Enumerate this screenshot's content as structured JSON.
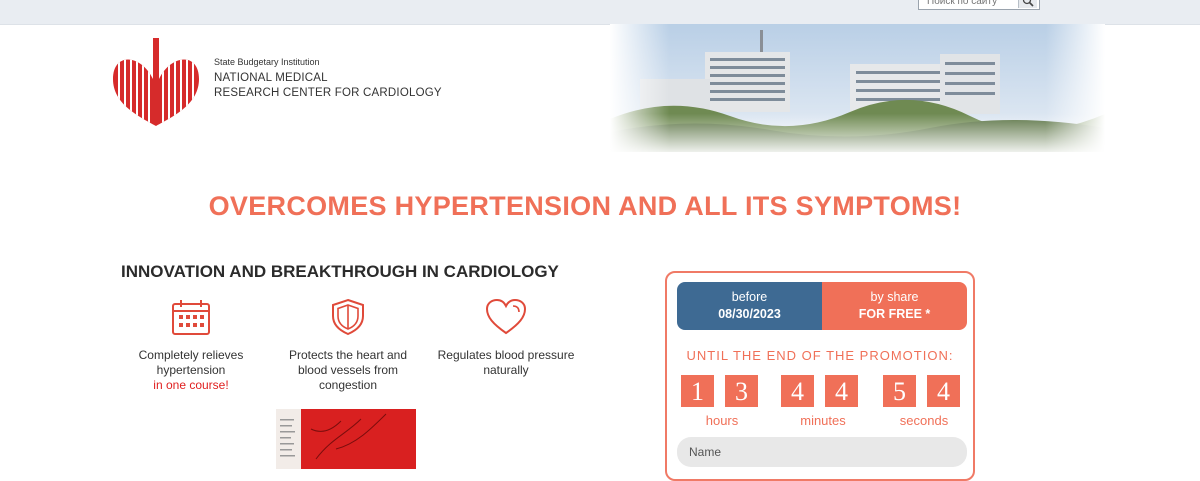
{
  "topbar": {
    "search_placeholder": "Поиск по сайту"
  },
  "org": {
    "small": "State Budgetary Institution",
    "line1": "NATIONAL MEDICAL",
    "line2": "RESEARCH CENTER FOR CARDIOLOGY"
  },
  "headline": "OVERCOMES HYPERTENSION AND ALL ITS SYMPTOMS!",
  "subhead": "INNOVATION AND BREAKTHROUGH IN CARDIOLOGY",
  "features": [
    {
      "icon": "calendar-icon",
      "text": "Completely relieves hypertension",
      "accent": "in one course!"
    },
    {
      "icon": "shield-icon",
      "text": "Protects the heart and blood vessels from congestion"
    },
    {
      "icon": "heart-icon",
      "text": "Regulates blood pressure naturally"
    }
  ],
  "offer": {
    "left_line1": "before",
    "left_line2": "08/30/2023",
    "right_line1": "by share",
    "right_line2": "FOR FREE *"
  },
  "promo_label": "UNTIL THE END OF THE PROMOTION:",
  "countdown": {
    "digits": [
      "1",
      "3",
      "4",
      "4",
      "5",
      "4"
    ],
    "hours_label": "hours",
    "minutes_label": "minutes",
    "seconds_label": "seconds"
  },
  "form": {
    "name_placeholder": "Name"
  },
  "colors": {
    "accent": "#f07058",
    "blue": "#3e6a93",
    "red": "#d92020"
  }
}
